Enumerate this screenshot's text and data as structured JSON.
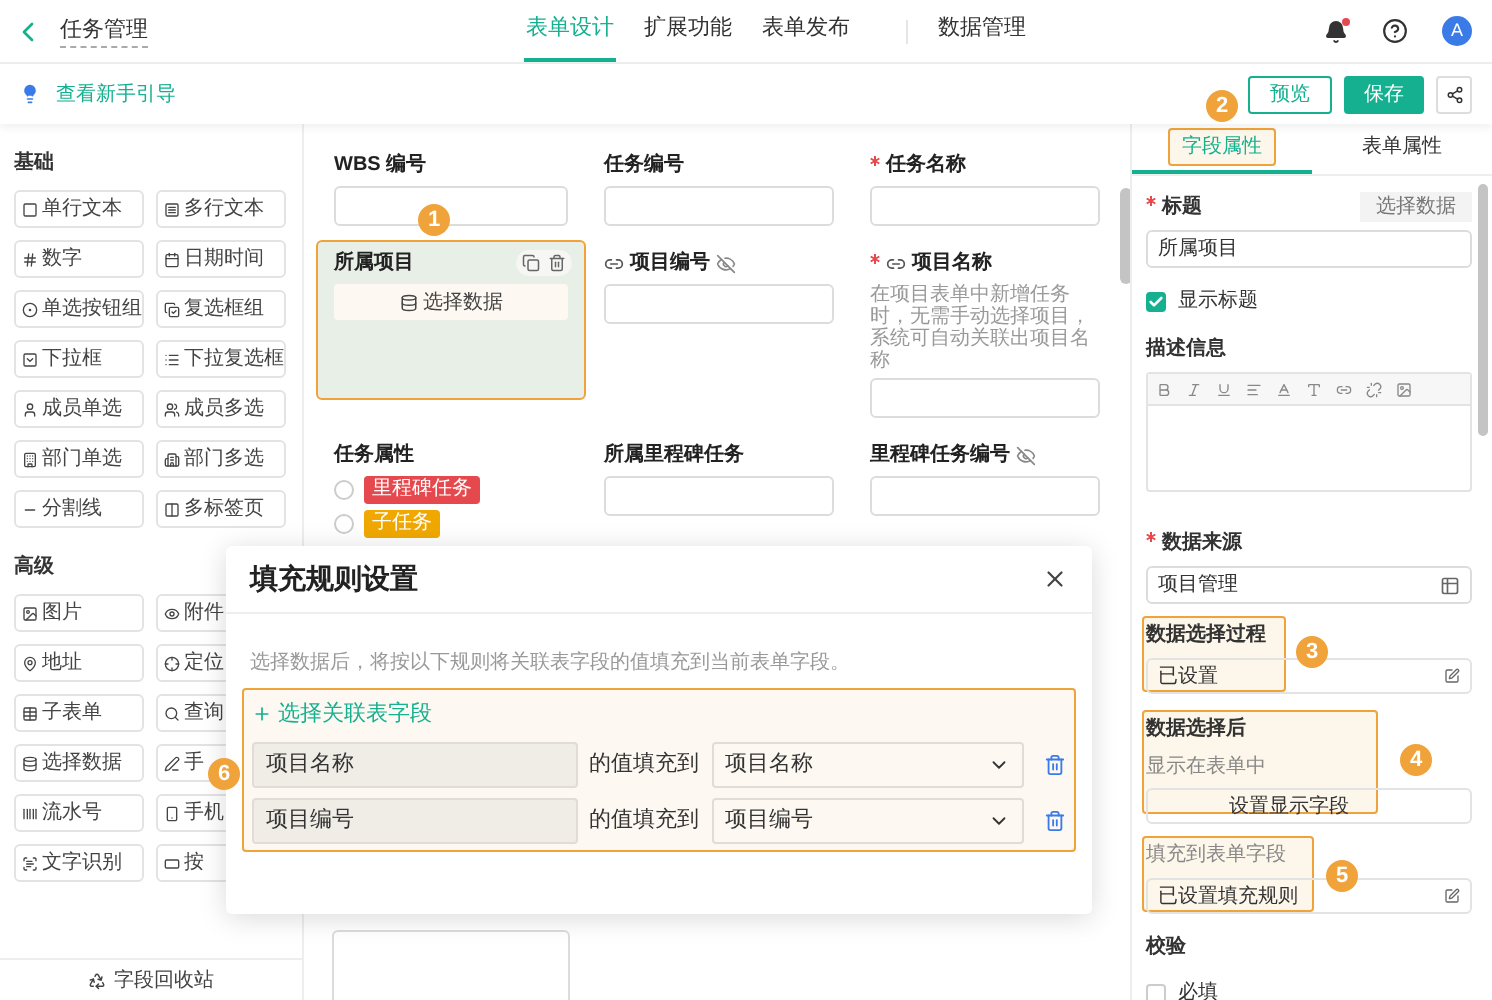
{
  "header": {
    "title": "任务管理",
    "tabs": [
      {
        "label": "表单设计",
        "selected": true
      },
      {
        "label": "扩展功能",
        "selected": false
      },
      {
        "label": "表单发布",
        "selected": false
      },
      {
        "label": "数据管理",
        "selected": false
      }
    ],
    "has_notification": true,
    "avatar": "A"
  },
  "toolbar": {
    "guide": "查看新手引导",
    "preview": "预览",
    "save": "保存"
  },
  "palette": {
    "groups": [
      {
        "title": "基础",
        "items": [
          "单行文本",
          "多行文本",
          "数字",
          "日期时间",
          "单选按钮组",
          "复选框组",
          "下拉框",
          "下拉复选框",
          "成员单选",
          "成员多选",
          "部门单选",
          "部门多选",
          "分割线",
          "多标签页"
        ]
      },
      {
        "title": "高级",
        "items": [
          "图片",
          "附件",
          "地址",
          "定位",
          "子表单",
          "查询",
          "选择数据",
          "手",
          "流水号",
          "手机",
          "文字识别",
          "按"
        ]
      }
    ],
    "recycle_bin": "字段回收站"
  },
  "canvas": {
    "fields": [
      {
        "kind": "input",
        "label": "WBS 编号",
        "selected": false
      },
      {
        "kind": "input",
        "label": "任务编号",
        "selected": false
      },
      {
        "kind": "input",
        "label": "任务名称",
        "required": true,
        "selected": false
      },
      {
        "kind": "select_data",
        "label": "所属项目",
        "button": "选择数据",
        "selected": true,
        "badge": "1"
      },
      {
        "kind": "input",
        "label": "项目编号",
        "linked": true,
        "hidden": true,
        "selected": false
      },
      {
        "kind": "input",
        "label": "项目名称",
        "required": true,
        "linked": true,
        "selected": false,
        "hint": "在项目表单中新增任务时，无需手动选择项目，系统可自动关联出项目名称"
      },
      {
        "kind": "radio",
        "label": "任务属性",
        "selected": false,
        "options": [
          {
            "label": "里程碑任务",
            "color": "#e5484d",
            "checked": false
          },
          {
            "label": "子任务",
            "color": "#f0a800",
            "checked": false
          }
        ]
      },
      {
        "kind": "input",
        "label": "所属里程碑任务",
        "selected": false
      },
      {
        "kind": "input",
        "label": "里程碑任务编号",
        "hidden": true,
        "selected": false
      }
    ]
  },
  "panel": {
    "tabs": [
      {
        "label": "字段属性",
        "selected": true,
        "badge": "2"
      },
      {
        "label": "表单属性",
        "selected": false
      }
    ],
    "title_label": "标题",
    "title_required": true,
    "source_required": true,
    "select_data": "选择数据",
    "title_value": "所属项目",
    "show_title": {
      "label": "显示标题",
      "checked": true
    },
    "description_label": "描述信息",
    "source_label": "数据来源",
    "source_value": "项目管理",
    "process": {
      "label": "数据选择过程",
      "value": "已设置",
      "badge": "3"
    },
    "after": {
      "label": "数据选择后",
      "sub": "显示在表单中",
      "button": "设置显示字段",
      "badge": "4"
    },
    "fill": {
      "label": "填充到表单字段",
      "value": "已设置填充规则",
      "badge": "5"
    },
    "validation": {
      "label": "校验",
      "options": [
        {
          "label": "必填",
          "checked": false
        }
      ]
    }
  },
  "modal": {
    "title": "填充规则设置",
    "description": "选择数据后，将按以下规则将关联表字段的值填充到当前表单字段。",
    "add": "选择关联表字段",
    "badge": "6",
    "rules": [
      {
        "source": "项目名称",
        "connector": "的值填充到",
        "target": "项目名称"
      },
      {
        "source": "项目编号",
        "connector": "的值填充到",
        "target": "项目编号"
      }
    ]
  }
}
